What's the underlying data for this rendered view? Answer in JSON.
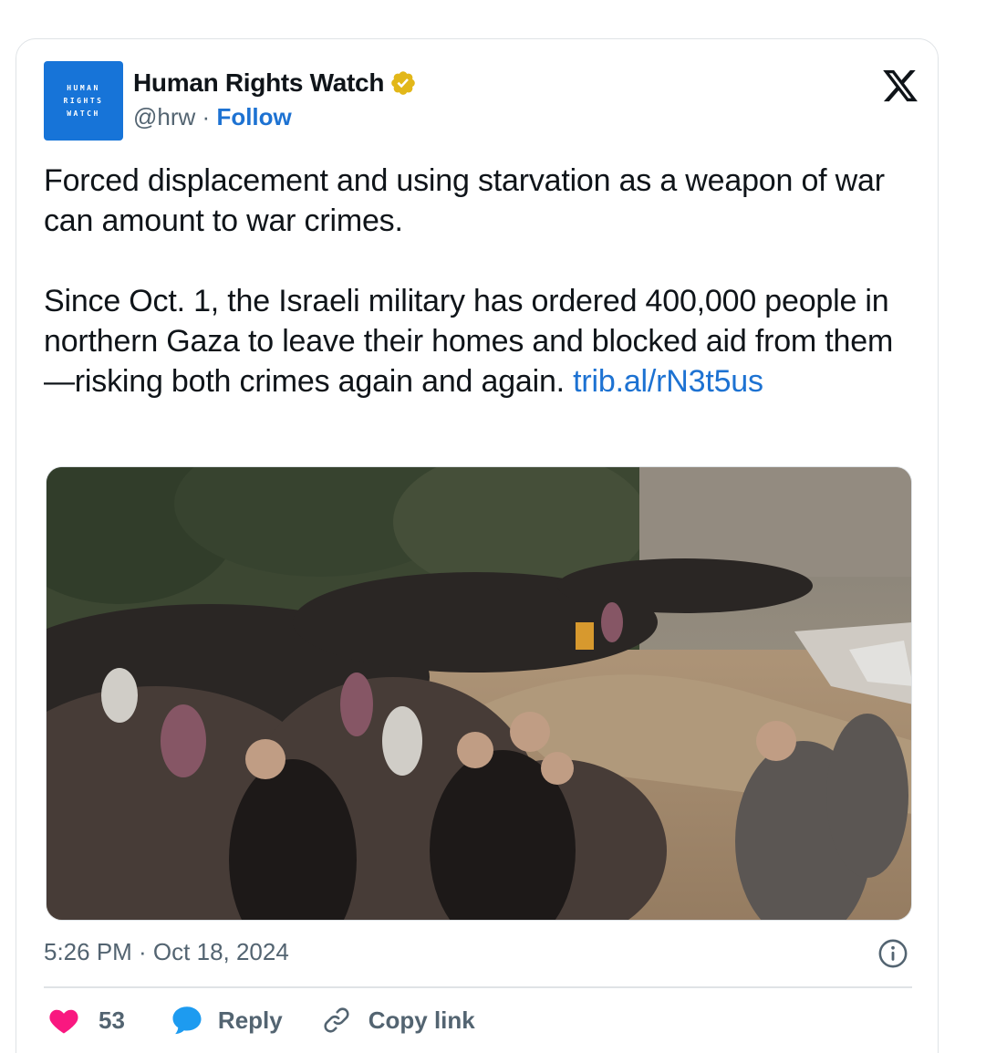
{
  "author": {
    "avatar_lines": [
      "HUMAN",
      "RIGHTS",
      "WATCH"
    ],
    "name": "Human Rights Watch",
    "handle": "@hrw",
    "separator": "·",
    "follow_label": "Follow"
  },
  "icons": {
    "verified": "verified-gold-badge-icon",
    "platform": "x-logo-icon",
    "info": "info-icon",
    "like": "heart-icon",
    "reply": "speech-bubble-icon",
    "copy": "link-icon"
  },
  "tweet": {
    "paragraph1": "Forced displacement and using starvation as a weapon of war can amount to war crimes.",
    "paragraph2": "Since Oct. 1, the Israeli military has ordered 400,000 people in northern Gaza to leave their homes and blocked aid from them—risking both crimes again and again.",
    "link": "trib.al/rN3t5us"
  },
  "timestamp": "5:26 PM · Oct 18, 2024",
  "actions": {
    "like_count": "53",
    "reply_label": "Reply",
    "copy_label": "Copy link"
  },
  "colors": {
    "brand_blue": "#1774d8",
    "link_blue": "#1d72d2",
    "like_pink": "#f91880",
    "secondary_text": "#536471",
    "verified_gold": "#e2b719"
  }
}
